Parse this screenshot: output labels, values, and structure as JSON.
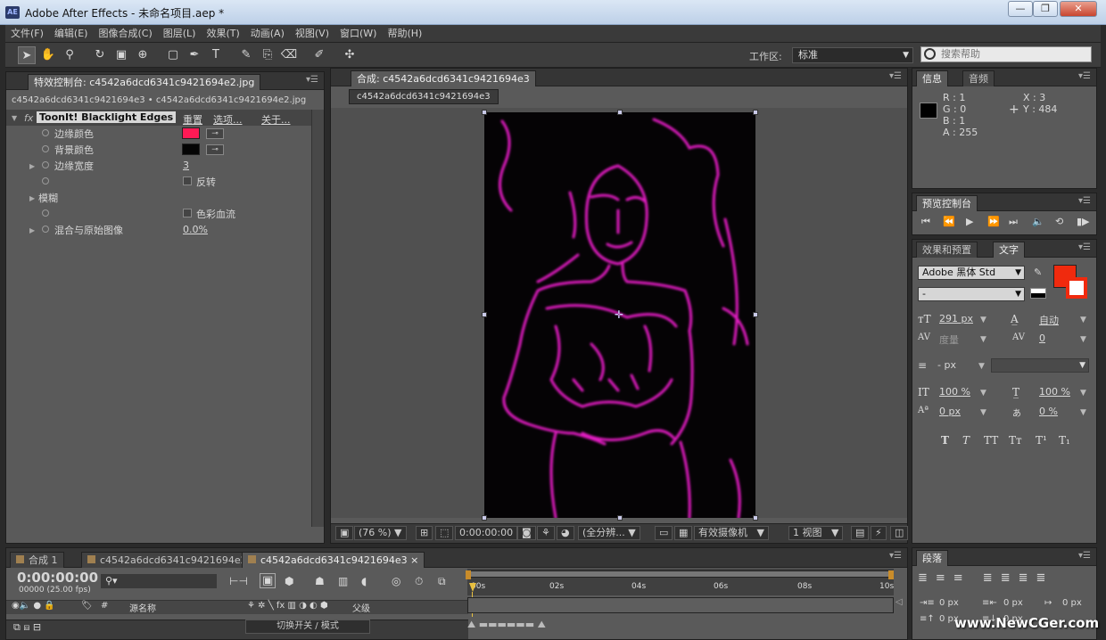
{
  "window": {
    "app_icon": "AE",
    "title": "Adobe After Effects - 未命名项目.aep *",
    "minimize": "—",
    "maximize": "❐",
    "close": "✕"
  },
  "menu": [
    "文件(F)",
    "编辑(E)",
    "图像合成(C)",
    "图层(L)",
    "效果(T)",
    "动画(A)",
    "视图(V)",
    "窗口(W)",
    "帮助(H)"
  ],
  "toolbar": {
    "workspace_label": "工作区:",
    "workspace_value": "标准",
    "search_placeholder": "搜索帮助"
  },
  "effects_panel": {
    "tab": "特效控制台: c4542a6dcd6341c9421694e2.jpg",
    "breadcrumb": "c4542a6dcd6341c9421694e3 • c4542a6dcd6341c9421694e2.jpg",
    "effect_name": "ToonIt! Blacklight Edges",
    "links": {
      "reset": "重置",
      "options": "选项...",
      "about": "关于..."
    },
    "props": {
      "edge_color": "边缘颜色",
      "edge_color_hex": "#ff1a55",
      "bg_color": "背景颜色",
      "bg_color_hex": "#050505",
      "edge_width": "边缘宽度",
      "edge_width_value": "3",
      "invert": "反转",
      "blur": "模糊",
      "color_bleed": "色彩血流",
      "blend": "混合与原始图像",
      "blend_value": "0.0%"
    }
  },
  "viewer": {
    "tab": "合成: c4542a6dcd6341c9421694e3",
    "subtab": "c4542a6dcd6341c9421694e3",
    "zoom": "(76 %)",
    "timecode": "0:00:00:00",
    "resolution": "(全分辨...",
    "camera": "有效摄像机",
    "views": "1 视图"
  },
  "info_panel": {
    "tabs": [
      "信息",
      "音频"
    ],
    "r": "R : 1",
    "g": "G : 0",
    "b": "B : 1",
    "a": "A : 255",
    "x": "X : 3",
    "y": "Y : 484"
  },
  "preview_panel": {
    "tab": "预览控制台"
  },
  "text_panel": {
    "tabs": [
      "效果和预置",
      "文字"
    ],
    "font": "Adobe 黑体 Std",
    "font_style": "-",
    "font_size": "291 px",
    "leading": "自动",
    "kerning": "度量",
    "tracking": "0",
    "stroke": "- px",
    "vscale": "100 %",
    "hscale": "100 %",
    "baseline": "0 px",
    "tsume": "0 %",
    "fill_color": "#f02a0e",
    "styles": [
      "T",
      "T",
      "TT",
      "Tт",
      "T¹",
      "T₁"
    ]
  },
  "paragraph_panel": {
    "tab": "段落",
    "fields": [
      "0 px",
      "0 px",
      "0 px",
      "0 px",
      "0 px"
    ]
  },
  "timeline": {
    "tabs": [
      "合成 1",
      "c4542a6dcd6341c9421694e2",
      "c4542a6dcd6341c9421694e3"
    ],
    "timecode": "0:00:00:00",
    "fps": "00000 (25.00 fps)",
    "source_name": "源名称",
    "parent": "父级",
    "hash": "#",
    "toggle_mode": "切换开关 / 模式",
    "ticks": [
      "00s",
      "02s",
      "04s",
      "06s",
      "08s",
      "10s"
    ]
  },
  "watermark": "www.NewCGer.com"
}
